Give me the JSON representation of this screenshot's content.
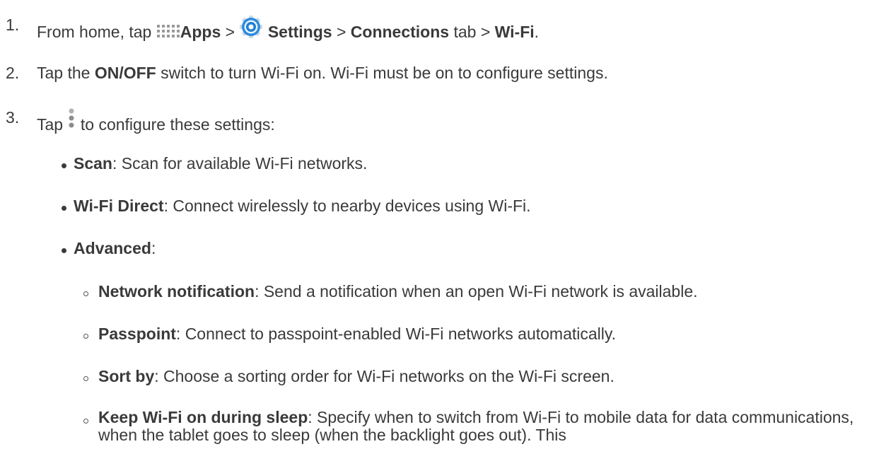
{
  "steps": [
    {
      "num": "1.",
      "lead": "From home, tap",
      "apps": "Apps",
      "sep1": ">",
      "settings": "Settings",
      "sep2": ">",
      "connections": "Connections",
      "tab_text": "tab >",
      "wifi": "Wi-Fi",
      "end": "."
    },
    {
      "num": "2.",
      "lead": "Tap the",
      "onoff": "ON/OFF",
      "rest": "switch to turn Wi-Fi on. Wi-Fi must be on to configure settings."
    },
    {
      "num": "3.",
      "lead": "Tap",
      "rest": "to configure these settings:"
    }
  ],
  "bullets": [
    {
      "term": "Scan",
      "desc": ": Scan for available Wi-Fi networks."
    },
    {
      "term": "Wi-Fi Direct",
      "desc": ": Connect wirelessly to nearby devices using Wi-Fi."
    },
    {
      "term": "Advanced",
      "desc": ":"
    }
  ],
  "sub_bullets": [
    {
      "term": "Network notification",
      "desc": ": Send a notification when an open Wi-Fi network is available."
    },
    {
      "term": "Passpoint",
      "desc": ": Connect to passpoint-enabled Wi-Fi networks automatically."
    },
    {
      "term": "Sort by",
      "desc": ": Choose a sorting order for Wi-Fi networks on the Wi-Fi screen."
    },
    {
      "term": "Keep Wi-Fi on during sleep",
      "desc": ": Specify when to switch from Wi-Fi to mobile data for data communications, when the tablet goes to sleep (when the backlight goes out). This"
    }
  ],
  "icons": {
    "apps": "apps-grid-icon",
    "settings": "settings-gear-icon",
    "menu": "more-options-icon"
  },
  "colors": {
    "text": "#3a3a3a",
    "apps_icon": "#9a9a9a",
    "gear_blue": "#1f7fd1"
  }
}
